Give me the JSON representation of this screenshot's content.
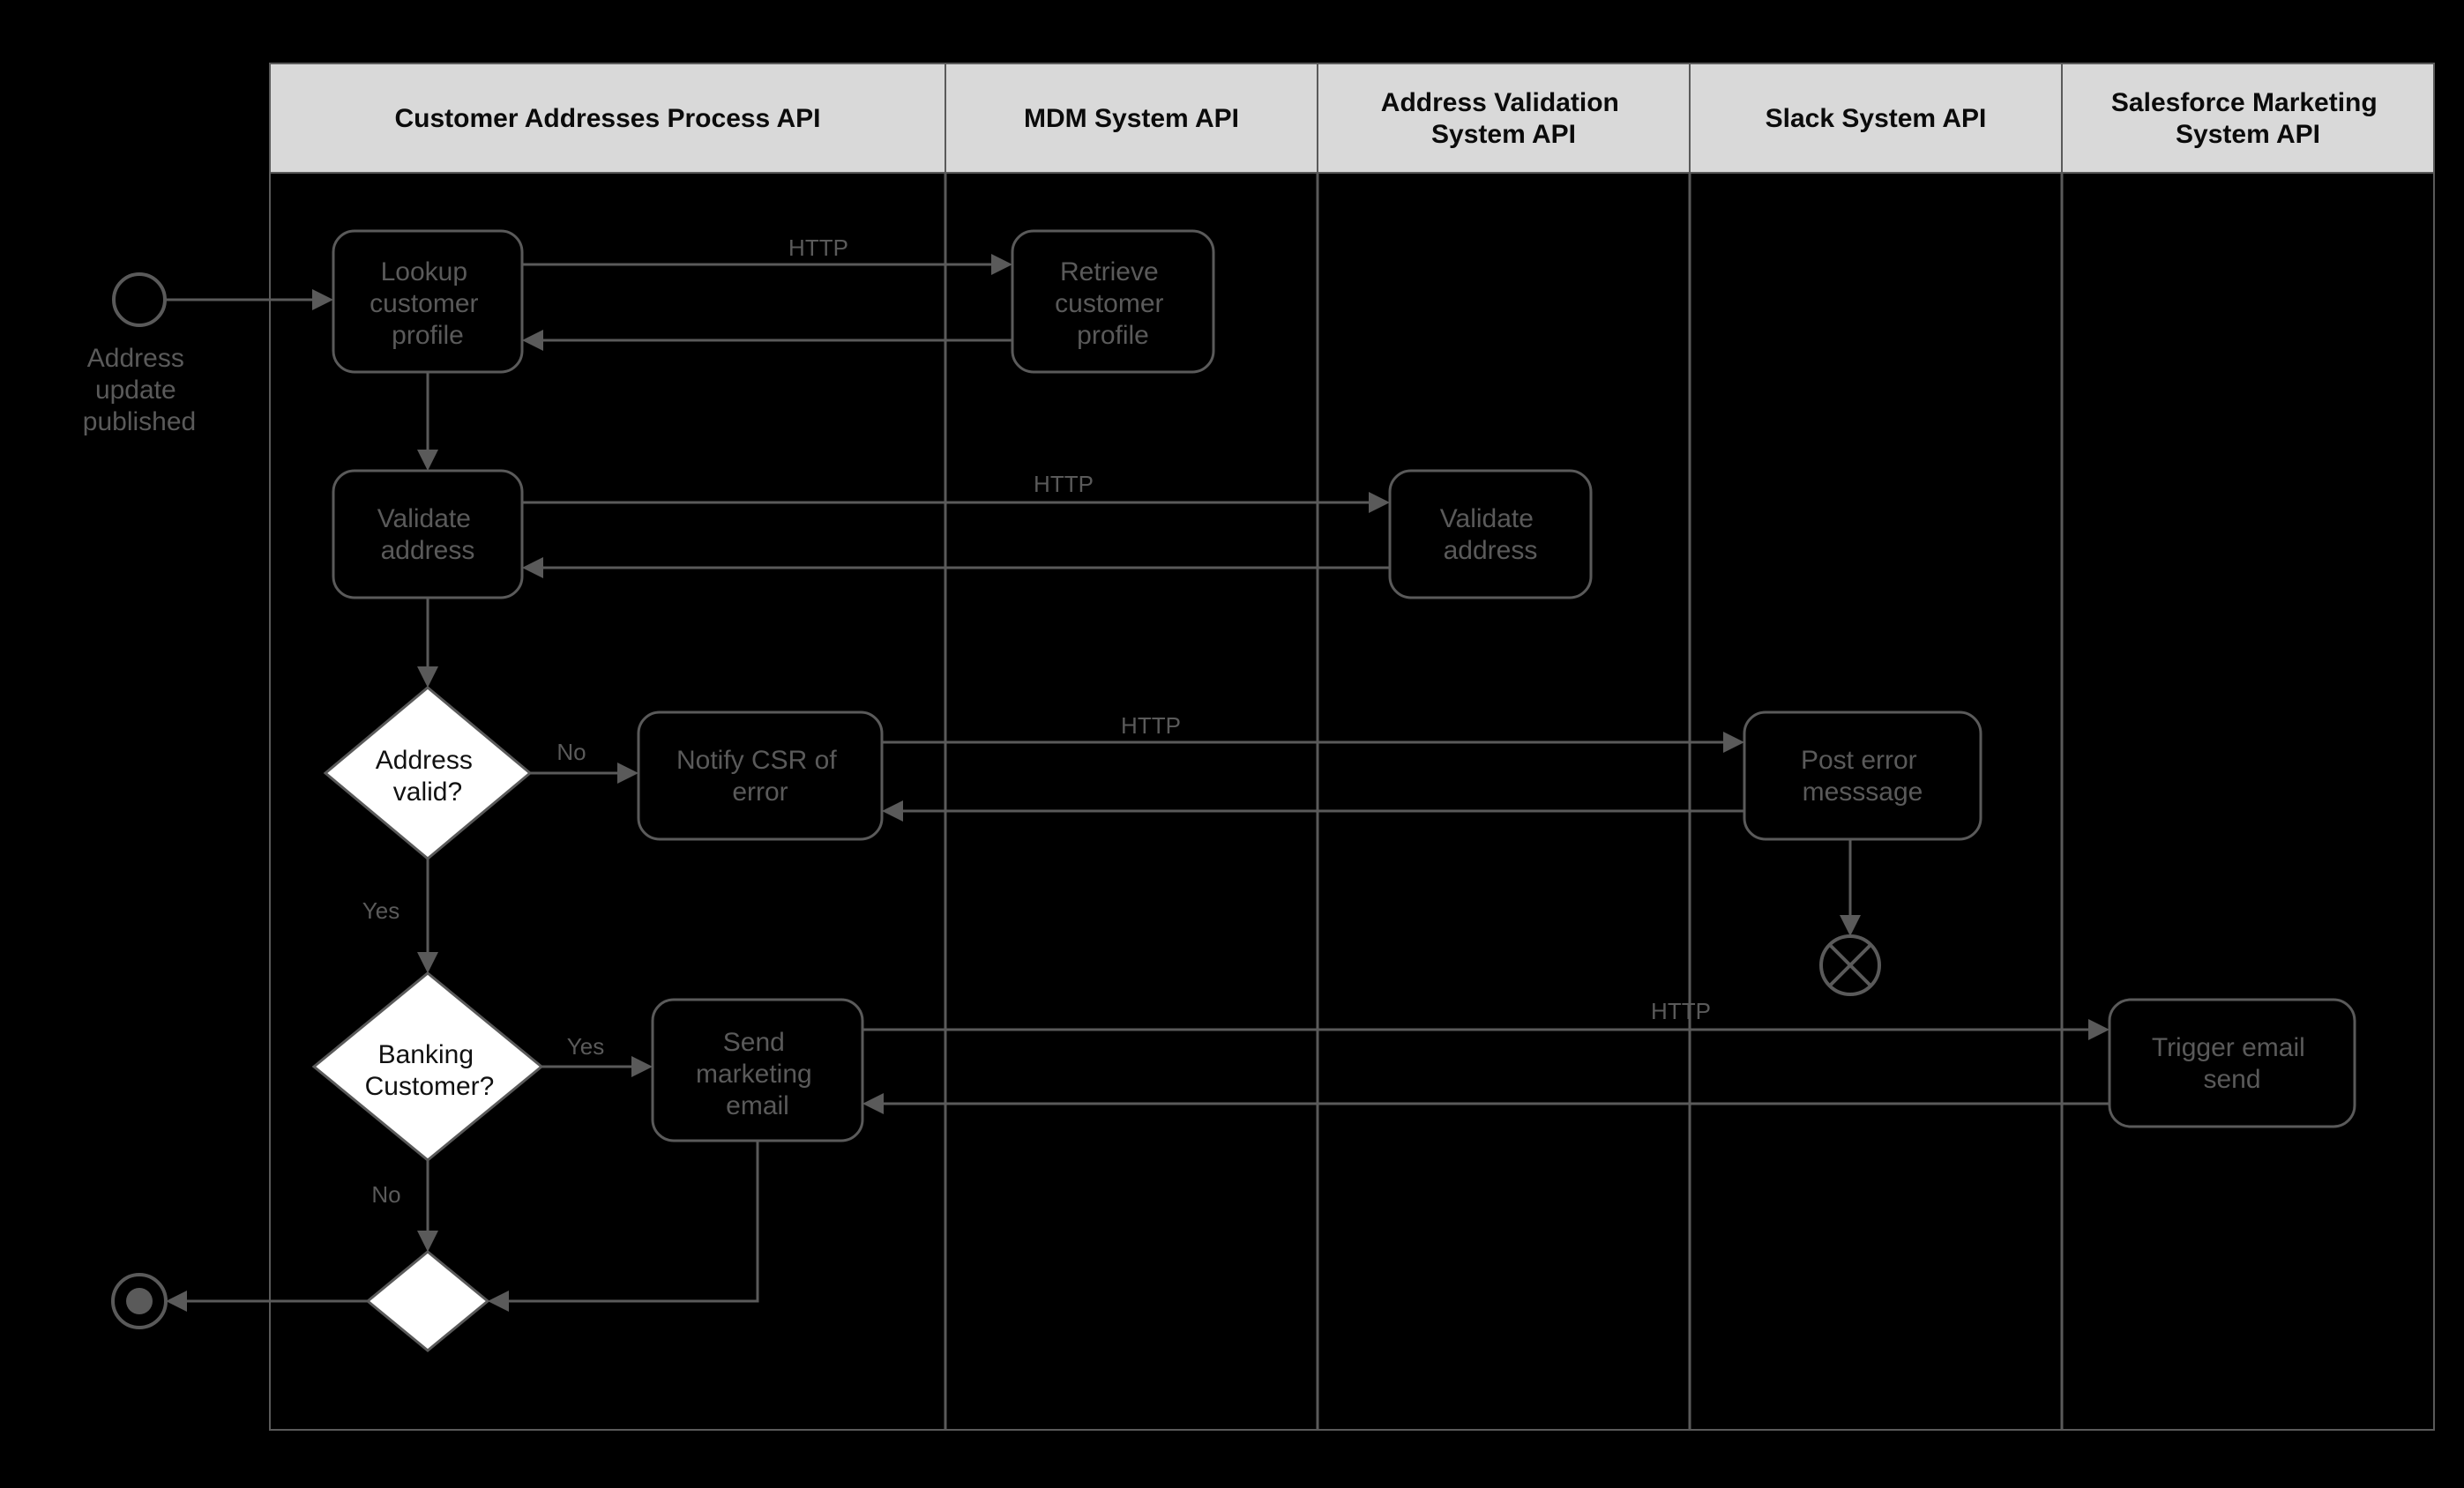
{
  "swimlanes": [
    {
      "id": "lane1",
      "title": "Customer Addresses Process API"
    },
    {
      "id": "lane2",
      "title": "MDM System API"
    },
    {
      "id": "lane3",
      "title": "Address Validation\nSystem API"
    },
    {
      "id": "lane4",
      "title": "Slack System API"
    },
    {
      "id": "lane5",
      "title": "Salesforce Marketing\nSystem API"
    }
  ],
  "start_event": {
    "label": "Address\nupdate\npublished"
  },
  "nodes": {
    "lookup": {
      "label": "Lookup\ncustomer\nprofile"
    },
    "retrieve": {
      "label": "Retrieve\ncustomer\nprofile"
    },
    "validate1": {
      "label": "Validate\naddress"
    },
    "validate2": {
      "label": "Validate\naddress"
    },
    "notify": {
      "label": "Notify CSR of\nerror"
    },
    "posterr": {
      "label": "Post error\nmesssage"
    },
    "sendemail": {
      "label": "Send\nmarketing\nemail"
    },
    "trigger": {
      "label": "Trigger email\nsend"
    }
  },
  "decisions": {
    "addr_valid": {
      "label": "Address\nvalid?",
      "yes": "Yes",
      "no": "No"
    },
    "banking": {
      "label": "Banking\nCustomer?",
      "yes": "Yes",
      "no": "No"
    },
    "merge": {
      "label": ""
    }
  },
  "edge_labels": {
    "http": "HTTP"
  }
}
